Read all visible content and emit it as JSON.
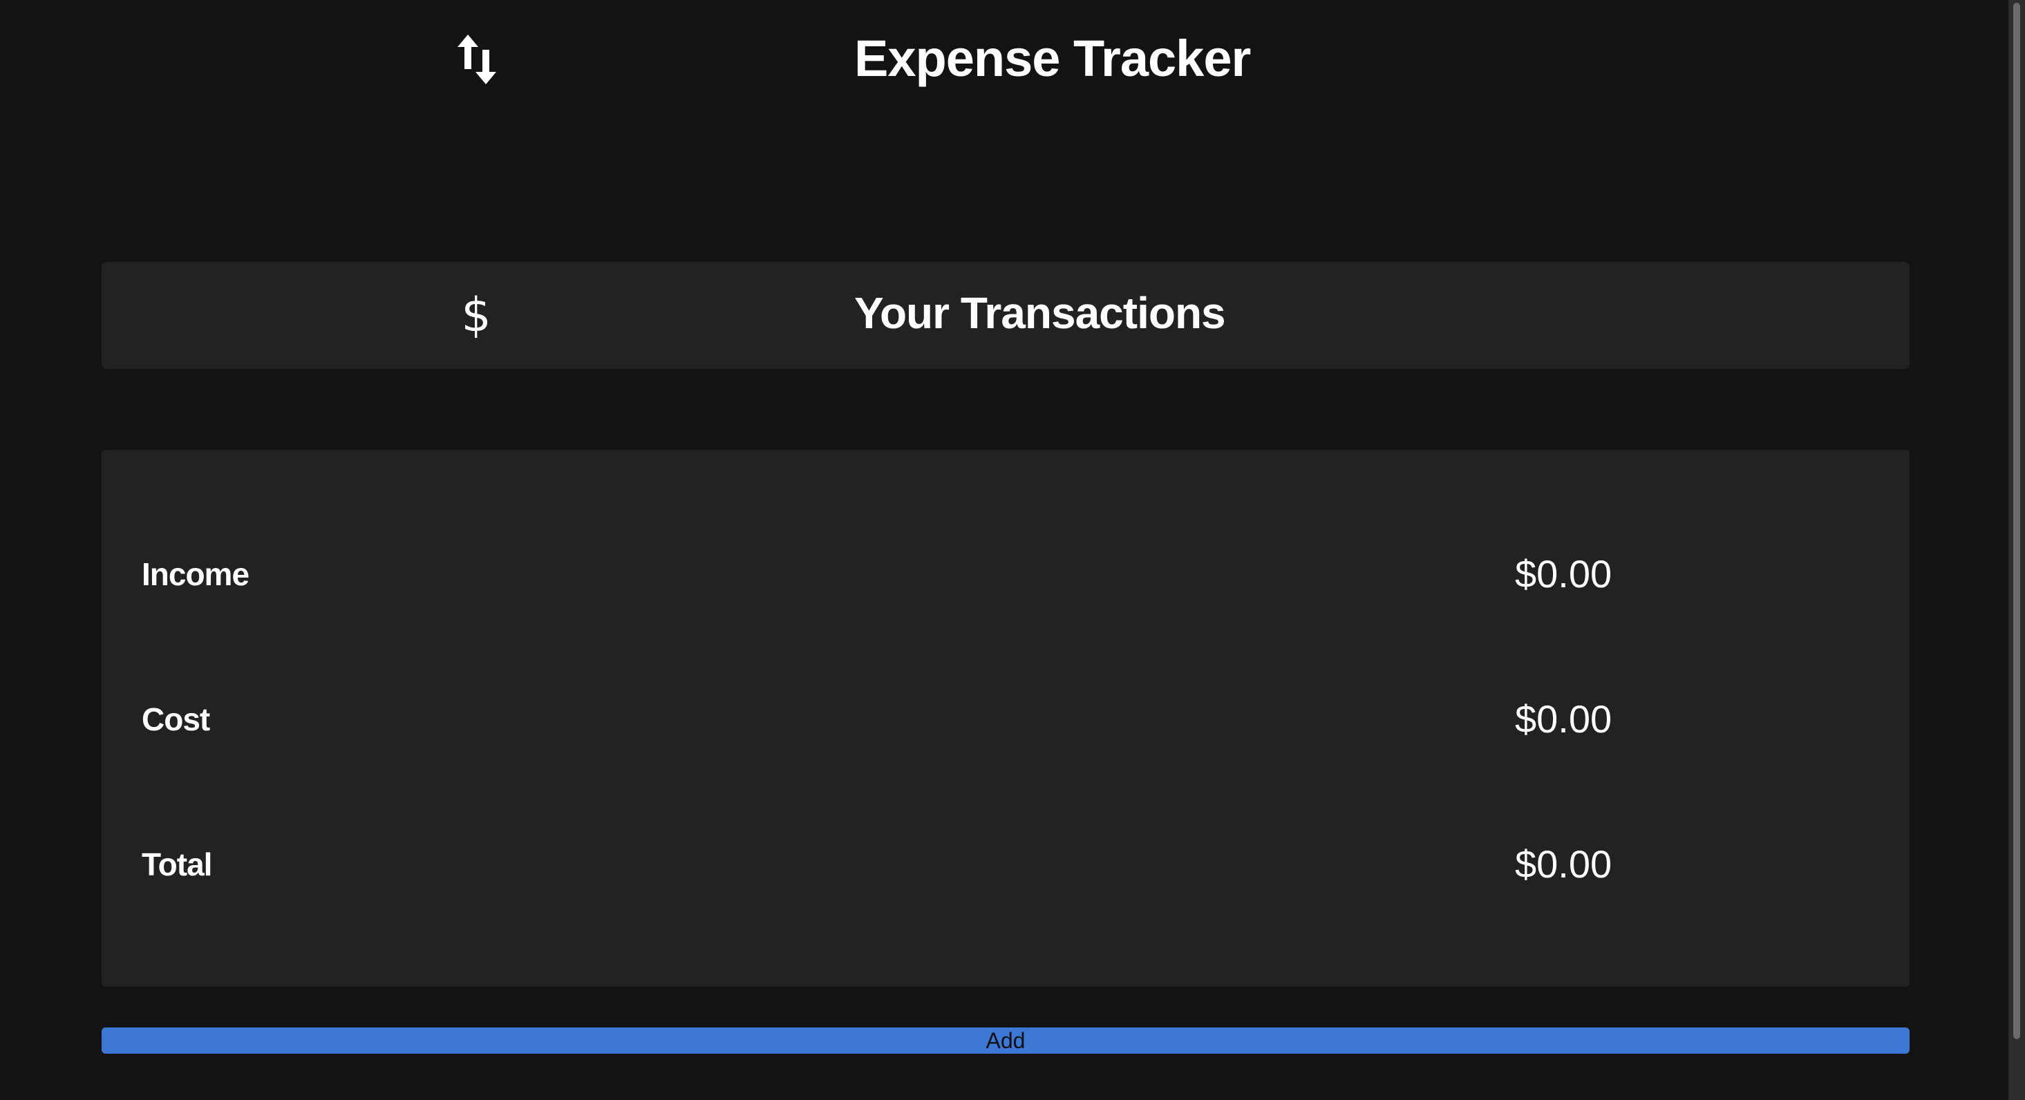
{
  "header": {
    "title": "Expense Tracker",
    "icon": "swap-vertical-icon"
  },
  "transactions": {
    "title": "Your Transactions",
    "icon": "dollar-icon"
  },
  "summary": {
    "rows": [
      {
        "label": "Income",
        "value": "$0.00"
      },
      {
        "label": "Cost",
        "value": "$0.00"
      },
      {
        "label": "Total",
        "value": "$0.00"
      }
    ]
  },
  "actions": {
    "add_label": "Add"
  },
  "colors": {
    "background": "#131313",
    "panel": "#222222",
    "accent": "#3e78d6",
    "text": "#ffffff"
  }
}
